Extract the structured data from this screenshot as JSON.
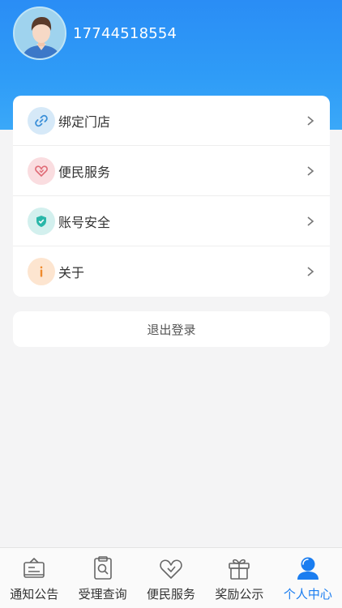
{
  "profile": {
    "phone": "17744518554"
  },
  "menu": {
    "items": [
      {
        "label": "绑定门店",
        "icon": "link-icon",
        "color": "#3a8fd8"
      },
      {
        "label": "便民服务",
        "icon": "heart-icon",
        "color": "#e06c77"
      },
      {
        "label": "账号安全",
        "icon": "shield-icon",
        "color": "#2ab7a9"
      },
      {
        "label": "关于",
        "icon": "info-icon",
        "color": "#ef8a2c"
      }
    ]
  },
  "logout": {
    "label": "退出登录"
  },
  "tabbar": {
    "items": [
      {
        "label": "通知公告",
        "icon": "notice-board-icon"
      },
      {
        "label": "受理查询",
        "icon": "clipboard-search-icon"
      },
      {
        "label": "便民服务",
        "icon": "heart-icon"
      },
      {
        "label": "奖励公示",
        "icon": "gift-icon"
      },
      {
        "label": "个人中心",
        "icon": "person-icon",
        "active": true
      }
    ]
  },
  "colors": {
    "header": "#2f9cf7",
    "active_tab": "#1a7df0"
  }
}
